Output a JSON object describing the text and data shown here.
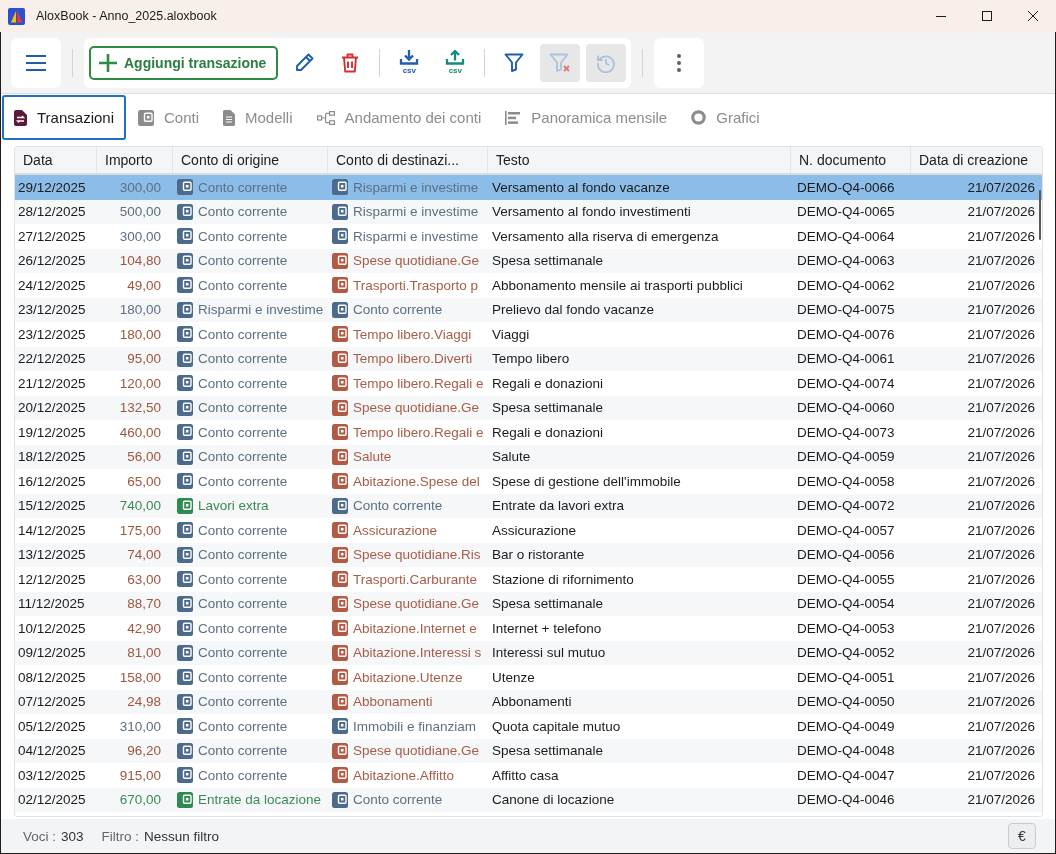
{
  "window": {
    "title": "AloxBook - Anno_2025.aloxbook"
  },
  "toolbar": {
    "add_button": {
      "label": "Aggiungi transazione"
    },
    "groups": [
      [
        {
          "kind": "edit",
          "disabled": false
        },
        {
          "kind": "delete",
          "disabled": false
        }
      ],
      [
        {
          "kind": "export",
          "label": "csv",
          "disabled": false
        },
        {
          "kind": "import",
          "label": "csv",
          "disabled": false
        }
      ],
      [
        {
          "kind": "filter",
          "disabled": false
        },
        {
          "kind": "clear_filter",
          "disabled": true
        },
        {
          "kind": "reset",
          "disabled": true
        }
      ]
    ]
  },
  "tabs": [
    {
      "label": "Transazioni",
      "kind": "transactions",
      "selected": true
    },
    {
      "label": "Conti",
      "kind": "accounts",
      "selected": false
    },
    {
      "label": "Modelli",
      "kind": "templates",
      "selected": false
    },
    {
      "label": "Andamento dei conti",
      "kind": "flow",
      "selected": false
    },
    {
      "label": "Panoramica mensile",
      "kind": "monthly",
      "selected": false
    },
    {
      "label": "Grafici",
      "kind": "charts",
      "selected": false
    }
  ],
  "table": {
    "columns": [
      "Data",
      "Importo",
      "Conto di origine",
      "Conto di destinazi...",
      "Testo",
      "N. documento",
      "Data di creazione"
    ],
    "rows": [
      {
        "date": "29/12/2025",
        "amount": "300,00",
        "kind": "transfer",
        "from": {
          "name": "Conto corrente",
          "kind": "asset"
        },
        "to": {
          "name": "Risparmi e investime",
          "kind": "asset"
        },
        "text": "Versamento al fondo vacanze",
        "document": "DEMO-Q4-0066",
        "created": "21/07/2026",
        "selected": true
      },
      {
        "date": "28/12/2025",
        "amount": "500,00",
        "kind": "transfer",
        "from": {
          "name": "Conto corrente",
          "kind": "asset"
        },
        "to": {
          "name": "Risparmi e investime",
          "kind": "asset"
        },
        "text": "Versamento al fondo investimenti",
        "document": "DEMO-Q4-0065",
        "created": "21/07/2026",
        "selected": false
      },
      {
        "date": "27/12/2025",
        "amount": "300,00",
        "kind": "transfer",
        "from": {
          "name": "Conto corrente",
          "kind": "asset"
        },
        "to": {
          "name": "Risparmi e investime",
          "kind": "asset"
        },
        "text": "Versamento alla riserva di emergenza",
        "document": "DEMO-Q4-0064",
        "created": "21/07/2026",
        "selected": false
      },
      {
        "date": "26/12/2025",
        "amount": "104,80",
        "kind": "expense",
        "from": {
          "name": "Conto corrente",
          "kind": "asset"
        },
        "to": {
          "name": "Spese quotidiane.Ge",
          "kind": "expense"
        },
        "text": "Spesa settimanale",
        "document": "DEMO-Q4-0063",
        "created": "21/07/2026",
        "selected": false
      },
      {
        "date": "24/12/2025",
        "amount": "49,00",
        "kind": "expense",
        "from": {
          "name": "Conto corrente",
          "kind": "asset"
        },
        "to": {
          "name": "Trasporti.Trasporto p",
          "kind": "expense"
        },
        "text": "Abbonamento mensile ai trasporti pubblici",
        "document": "DEMO-Q4-0062",
        "created": "21/07/2026",
        "selected": false
      },
      {
        "date": "23/12/2025",
        "amount": "180,00",
        "kind": "transfer",
        "from": {
          "name": "Risparmi e investime",
          "kind": "asset"
        },
        "to": {
          "name": "Conto corrente",
          "kind": "asset"
        },
        "text": "Prelievo dal fondo vacanze",
        "document": "DEMO-Q4-0075",
        "created": "21/07/2026",
        "selected": false
      },
      {
        "date": "23/12/2025",
        "amount": "180,00",
        "kind": "expense",
        "from": {
          "name": "Conto corrente",
          "kind": "asset"
        },
        "to": {
          "name": "Tempo libero.Viaggi",
          "kind": "expense"
        },
        "text": "Viaggi",
        "document": "DEMO-Q4-0076",
        "created": "21/07/2026",
        "selected": false
      },
      {
        "date": "22/12/2025",
        "amount": "95,00",
        "kind": "expense",
        "from": {
          "name": "Conto corrente",
          "kind": "asset"
        },
        "to": {
          "name": "Tempo libero.Diverti",
          "kind": "expense"
        },
        "text": "Tempo libero",
        "document": "DEMO-Q4-0061",
        "created": "21/07/2026",
        "selected": false
      },
      {
        "date": "21/12/2025",
        "amount": "120,00",
        "kind": "expense",
        "from": {
          "name": "Conto corrente",
          "kind": "asset"
        },
        "to": {
          "name": "Tempo libero.Regali e",
          "kind": "expense"
        },
        "text": "Regali e donazioni",
        "document": "DEMO-Q4-0074",
        "created": "21/07/2026",
        "selected": false
      },
      {
        "date": "20/12/2025",
        "amount": "132,50",
        "kind": "expense",
        "from": {
          "name": "Conto corrente",
          "kind": "asset"
        },
        "to": {
          "name": "Spese quotidiane.Ge",
          "kind": "expense"
        },
        "text": "Spesa settimanale",
        "document": "DEMO-Q4-0060",
        "created": "21/07/2026",
        "selected": false
      },
      {
        "date": "19/12/2025",
        "amount": "460,00",
        "kind": "expense",
        "from": {
          "name": "Conto corrente",
          "kind": "asset"
        },
        "to": {
          "name": "Tempo libero.Regali e",
          "kind": "expense"
        },
        "text": "Regali e donazioni",
        "document": "DEMO-Q4-0073",
        "created": "21/07/2026",
        "selected": false
      },
      {
        "date": "18/12/2025",
        "amount": "56,00",
        "kind": "expense",
        "from": {
          "name": "Conto corrente",
          "kind": "asset"
        },
        "to": {
          "name": "Salute",
          "kind": "expense"
        },
        "text": "Salute",
        "document": "DEMO-Q4-0059",
        "created": "21/07/2026",
        "selected": false
      },
      {
        "date": "16/12/2025",
        "amount": "65,00",
        "kind": "expense",
        "from": {
          "name": "Conto corrente",
          "kind": "asset"
        },
        "to": {
          "name": "Abitazione.Spese del",
          "kind": "expense"
        },
        "text": "Spese di gestione dell'immobile",
        "document": "DEMO-Q4-0058",
        "created": "21/07/2026",
        "selected": false
      },
      {
        "date": "15/12/2025",
        "amount": "740,00",
        "kind": "income",
        "from": {
          "name": "Lavori extra",
          "kind": "income"
        },
        "to": {
          "name": "Conto corrente",
          "kind": "asset"
        },
        "text": "Entrate da lavori extra",
        "document": "DEMO-Q4-0072",
        "created": "21/07/2026",
        "selected": false
      },
      {
        "date": "14/12/2025",
        "amount": "175,00",
        "kind": "expense",
        "from": {
          "name": "Conto corrente",
          "kind": "asset"
        },
        "to": {
          "name": "Assicurazione",
          "kind": "expense"
        },
        "text": "Assicurazione",
        "document": "DEMO-Q4-0057",
        "created": "21/07/2026",
        "selected": false
      },
      {
        "date": "13/12/2025",
        "amount": "74,00",
        "kind": "expense",
        "from": {
          "name": "Conto corrente",
          "kind": "asset"
        },
        "to": {
          "name": "Spese quotidiane.Ris",
          "kind": "expense"
        },
        "text": "Bar o ristorante",
        "document": "DEMO-Q4-0056",
        "created": "21/07/2026",
        "selected": false
      },
      {
        "date": "12/12/2025",
        "amount": "63,00",
        "kind": "expense",
        "from": {
          "name": "Conto corrente",
          "kind": "asset"
        },
        "to": {
          "name": "Trasporti.Carburante",
          "kind": "expense"
        },
        "text": "Stazione di rifornimento",
        "document": "DEMO-Q4-0055",
        "created": "21/07/2026",
        "selected": false
      },
      {
        "date": "11/12/2025",
        "amount": "88,70",
        "kind": "expense",
        "from": {
          "name": "Conto corrente",
          "kind": "asset"
        },
        "to": {
          "name": "Spese quotidiane.Ge",
          "kind": "expense"
        },
        "text": "Spesa settimanale",
        "document": "DEMO-Q4-0054",
        "created": "21/07/2026",
        "selected": false
      },
      {
        "date": "10/12/2025",
        "amount": "42,90",
        "kind": "expense",
        "from": {
          "name": "Conto corrente",
          "kind": "asset"
        },
        "to": {
          "name": "Abitazione.Internet e",
          "kind": "expense"
        },
        "text": "Internet + telefono",
        "document": "DEMO-Q4-0053",
        "created": "21/07/2026",
        "selected": false
      },
      {
        "date": "09/12/2025",
        "amount": "81,00",
        "kind": "expense",
        "from": {
          "name": "Conto corrente",
          "kind": "asset"
        },
        "to": {
          "name": "Abitazione.Interessi s",
          "kind": "expense"
        },
        "text": "Interessi sul mutuo",
        "document": "DEMO-Q4-0052",
        "created": "21/07/2026",
        "selected": false
      },
      {
        "date": "08/12/2025",
        "amount": "158,00",
        "kind": "expense",
        "from": {
          "name": "Conto corrente",
          "kind": "asset"
        },
        "to": {
          "name": "Abitazione.Utenze",
          "kind": "expense"
        },
        "text": "Utenze",
        "document": "DEMO-Q4-0051",
        "created": "21/07/2026",
        "selected": false
      },
      {
        "date": "07/12/2025",
        "amount": "24,98",
        "kind": "expense",
        "from": {
          "name": "Conto corrente",
          "kind": "asset"
        },
        "to": {
          "name": "Abbonamenti",
          "kind": "expense"
        },
        "text": "Abbonamenti",
        "document": "DEMO-Q4-0050",
        "created": "21/07/2026",
        "selected": false
      },
      {
        "date": "05/12/2025",
        "amount": "310,00",
        "kind": "transfer",
        "from": {
          "name": "Conto corrente",
          "kind": "asset"
        },
        "to": {
          "name": "Immobili e finanziam",
          "kind": "asset"
        },
        "text": "Quota capitale mutuo",
        "document": "DEMO-Q4-0049",
        "created": "21/07/2026",
        "selected": false
      },
      {
        "date": "04/12/2025",
        "amount": "96,20",
        "kind": "expense",
        "from": {
          "name": "Conto corrente",
          "kind": "asset"
        },
        "to": {
          "name": "Spese quotidiane.Ge",
          "kind": "expense"
        },
        "text": "Spesa settimanale",
        "document": "DEMO-Q4-0048",
        "created": "21/07/2026",
        "selected": false
      },
      {
        "date": "03/12/2025",
        "amount": "915,00",
        "kind": "expense",
        "from": {
          "name": "Conto corrente",
          "kind": "asset"
        },
        "to": {
          "name": "Abitazione.Affitto",
          "kind": "expense"
        },
        "text": "Affitto casa",
        "document": "DEMO-Q4-0047",
        "created": "21/07/2026",
        "selected": false
      },
      {
        "date": "02/12/2025",
        "amount": "670,00",
        "kind": "income",
        "from": {
          "name": "Entrate da locazione",
          "kind": "income"
        },
        "to": {
          "name": "Conto corrente",
          "kind": "asset"
        },
        "text": "Canone di locazione",
        "document": "DEMO-Q4-0046",
        "created": "21/07/2026",
        "selected": false
      }
    ]
  },
  "status_bar": {
    "items": [
      {
        "label": "Voci :",
        "value": "303"
      },
      {
        "label": "Filtro :",
        "value": "Nessun filtro"
      }
    ],
    "currency_button": {
      "label": "€"
    }
  }
}
